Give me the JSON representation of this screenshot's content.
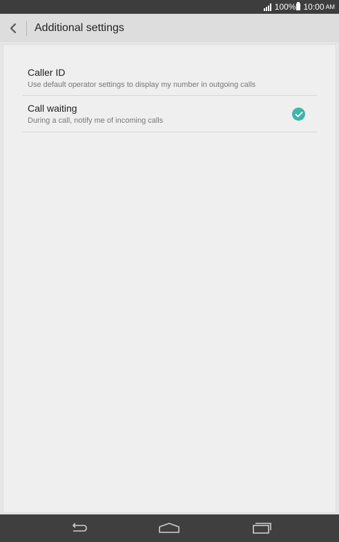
{
  "status_bar": {
    "battery_percent": "100%",
    "time": "10:00",
    "ampm": "AM",
    "icons": [
      "signal-icon",
      "battery-icon"
    ]
  },
  "action_bar": {
    "title": "Additional settings",
    "back_icon": "chevron-left-icon"
  },
  "settings": [
    {
      "title": "Caller ID",
      "subtitle": "Use default operator settings to display my number in outgoing calls",
      "checked": null
    },
    {
      "title": "Call waiting",
      "subtitle": "During a call, notify me of incoming calls",
      "checked": true
    }
  ],
  "nav_bar": {
    "icons": [
      "back-icon",
      "home-icon",
      "recent-apps-icon"
    ]
  },
  "colors": {
    "accent": "#3fb5aa",
    "status_bar": "#3d3d3d",
    "action_bar": "#dddddd",
    "nav_bar": "#3f3f3f"
  }
}
